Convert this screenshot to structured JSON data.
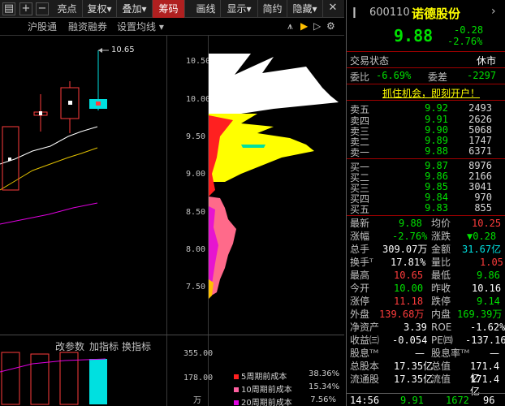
{
  "toolbar": {
    "items": [
      "亮点",
      "复权",
      "叠加",
      "筹码",
      "画线",
      "显示",
      "简约",
      "隐藏"
    ],
    "active": "筹码"
  },
  "subtabs": [
    "沪股通",
    "融资融券",
    "设置均线"
  ],
  "chart": {
    "high_marker": "10.65",
    "price_labels": [
      "10.50",
      "10.00",
      "9.50",
      "9.00",
      "8.50",
      "8.00",
      "7.50"
    ],
    "indicator_tabs": [
      "改参数",
      "加指标",
      "换指标"
    ],
    "volume_labels": [
      "355.00",
      "178.00",
      "万"
    ],
    "legend": [
      {
        "label": "5周期前成本",
        "pct": "38.36%",
        "color": "#ff2020"
      },
      {
        "label": "10周期前成本",
        "pct": "15.34%",
        "color": "#ff60a0"
      },
      {
        "label": "20周期前成本",
        "pct": "7.56%",
        "color": "#e000e0"
      }
    ]
  },
  "stock": {
    "code": "600110",
    "name": "诺德股份",
    "price": "9.88",
    "change": "-0.28",
    "change_pct": "-2.76%"
  },
  "status": {
    "label": "交易状态",
    "value": "休市"
  },
  "weibi": {
    "label": "委比",
    "value": "-6.69%",
    "label2": "委差",
    "value2": "-2297"
  },
  "promo": "抓住机会，即刻开户！",
  "sell": [
    {
      "label": "卖五",
      "price": "9.92",
      "vol": "2493"
    },
    {
      "label": "卖四",
      "price": "9.91",
      "vol": "2626"
    },
    {
      "label": "卖三",
      "price": "9.90",
      "vol": "5068"
    },
    {
      "label": "卖二",
      "price": "9.89",
      "vol": "1747"
    },
    {
      "label": "卖一",
      "price": "9.88",
      "vol": "6371"
    }
  ],
  "buy": [
    {
      "label": "买一",
      "price": "9.87",
      "vol": "8976"
    },
    {
      "label": "买二",
      "price": "9.86",
      "vol": "2166"
    },
    {
      "label": "买三",
      "price": "9.85",
      "vol": "3041"
    },
    {
      "label": "买四",
      "price": "9.84",
      "vol": "970"
    },
    {
      "label": "买五",
      "price": "9.83",
      "vol": "855"
    }
  ],
  "stats": {
    "zuixin": "9.88",
    "junjia": "10.25",
    "zhangfu": "-2.76%",
    "zhangdie": "▼0.28",
    "zongshou": "309.07万",
    "jine": "31.67亿",
    "huanshou": "17.81%",
    "liangbi": "1.05",
    "zuigao": "10.65",
    "zuidi": "9.86",
    "jinkai": "10.00",
    "zuoshou": "10.16",
    "zhangting": "11.18",
    "dieting": "9.14",
    "waipan": "139.68万",
    "neipan": "169.39万",
    "jingzichan": "3.39",
    "roe": "-1.62%",
    "shouyi": "-0.054",
    "pe": "-137.16",
    "guxi": "—",
    "guxilv": "—",
    "zongguben": "17.35亿",
    "zongzhi": "171.4亿",
    "liutong": "17.35亿",
    "liuzhi": "171.4亿"
  },
  "tick": {
    "time": "14:56",
    "price": "9.91",
    "vol": "1672",
    "count": "96"
  }
}
